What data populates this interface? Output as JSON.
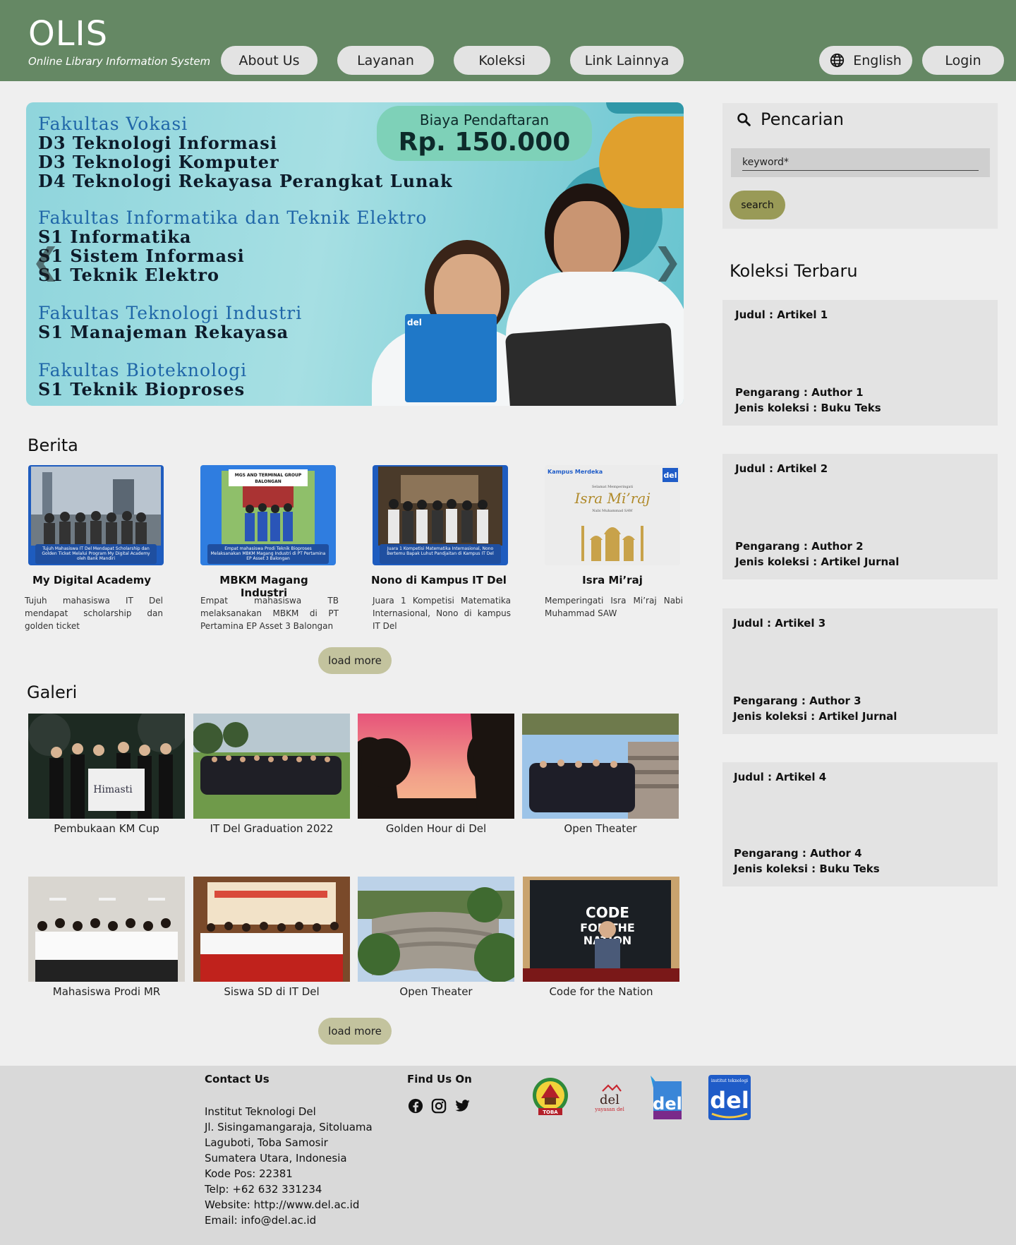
{
  "header": {
    "title": "OLIS",
    "subtitle": "Online Library Information System",
    "nav": [
      "About Us",
      "Layanan",
      "Koleksi",
      "Link Lainnya"
    ],
    "language": "English",
    "login": "Login"
  },
  "banner": {
    "fee_label": "Biaya Pendaftaran",
    "fee_amount": "Rp. 150.000",
    "faculties": [
      {
        "name": "Fakultas Vokasi",
        "programs": [
          "D3 Teknologi Informasi",
          "D3 Teknologi Komputer",
          "D4 Teknologi Rekayasa Perangkat Lunak"
        ]
      },
      {
        "name": "Fakultas Informatika dan Teknik Elektro",
        "programs": [
          "S1 Informatika",
          "S1 Sistem Informasi",
          "S1 Teknik Elektro"
        ]
      },
      {
        "name": "Fakultas Teknologi Industri",
        "programs": [
          "S1 Manajeman Rekayasa"
        ]
      },
      {
        "name": "Fakultas Bioteknologi",
        "programs": [
          "S1 Teknik Bioproses"
        ]
      }
    ],
    "book_label": "del",
    "prev_icon": "chevron-left-icon",
    "next_icon": "chevron-right-icon"
  },
  "berita": {
    "title": "Berita",
    "items": [
      {
        "title": "My Digital Academy",
        "desc": "Tujuh mahasiswa IT Del mendapat scholarship dan golden ticket",
        "caption": "Tujuh Mahasiswa IT Del Mendapat Scholarship dan Golden Ticket Melalui Program My Digital Academy oleh Bank Mandiri"
      },
      {
        "title": "MBKM Magang Industri",
        "desc": "Empat mahasiswa TB melaksanakan MBKM di PT Pertamina EP Asset 3 Balongan",
        "caption": "Empat mahasiswa Prodi Teknik Bioproses Melaksanakan MBKM Magang Industri di PT Pertamina EP Asset 3 Balongan",
        "sign": "MGS AND TERMINAL GROUP BALONGAN"
      },
      {
        "title": "Nono di Kampus IT Del",
        "desc": "Juara 1 Kompetisi Matematika Internasional, Nono di kampus IT Del",
        "caption": "Juara 1 Kompetisi Matematika Internasional, Nono Bertemu Bapak Luhut Pandjaitan di Kampus IT Del"
      },
      {
        "title": "Isra Mi’raj",
        "desc": "Memperingati Isra Mi’raj Nabi Muhammad SAW",
        "poster_top": "Selamat Memperingati",
        "poster_main": "Isra Mi’raj",
        "poster_sub": "Nabi Muhammad SAW",
        "poster_badge": "Kampus Merdeka",
        "poster_logo": "del"
      }
    ],
    "load_more": "load more"
  },
  "galeri": {
    "title": "Galeri",
    "items": [
      "Pembukaan KM Cup",
      "IT Del Graduation 2022",
      "Golden Hour di Del",
      "Open Theater",
      "Mahasiswa Prodi MR",
      "Siswa SD di IT Del",
      "Open Theater",
      "Code for the Nation"
    ],
    "banner_text": "Himasti",
    "code_text": "CODE FOR THE NATION",
    "load_more": "load more"
  },
  "sidebar": {
    "search_title": "Pencarian",
    "search_placeholder": "keyword*",
    "search_button": "search",
    "koleksi_title": "Koleksi Terbaru",
    "items": [
      {
        "judul": "Judul : Artikel 1",
        "pengarang": "Pengarang : Author 1",
        "jenis": "Jenis koleksi : Buku Teks"
      },
      {
        "judul": "Judul : Artikel 2",
        "pengarang": "Pengarang : Author 2",
        "jenis": "Jenis koleksi : Artikel Jurnal"
      },
      {
        "judul": "Judul : Artikel 3",
        "pengarang": "Pengarang : Author 3",
        "jenis": "Jenis koleksi : Artikel Jurnal"
      },
      {
        "judul": "Judul : Artikel 4",
        "pengarang": "Pengarang : Author 4",
        "jenis": "Jenis koleksi : Buku Teks"
      }
    ]
  },
  "footer": {
    "contact_title": "Contact Us",
    "address": [
      "Institut Teknologi Del",
      "Jl. Sisingamangaraja, Sitoluama",
      "Laguboti, Toba Samosir",
      "Sumatera Utara, Indonesia",
      "Kode Pos: 22381",
      "Telp: +62 632 331234",
      "Website: http://www.del.ac.id",
      "Email: info@del.ac.id"
    ],
    "find_title": "Find Us On",
    "social": [
      "facebook-icon",
      "instagram-icon",
      "twitter-icon"
    ],
    "logos": {
      "toba": "TOBA",
      "yayasan_main": "del",
      "yayasan_sub": "yayasan del",
      "sekolah": "del",
      "institut_top": "institut teknologi",
      "institut_main": "del"
    }
  },
  "colors": {
    "header": "#658864",
    "load_more": "#c3c39e",
    "search_button": "#999a57"
  }
}
